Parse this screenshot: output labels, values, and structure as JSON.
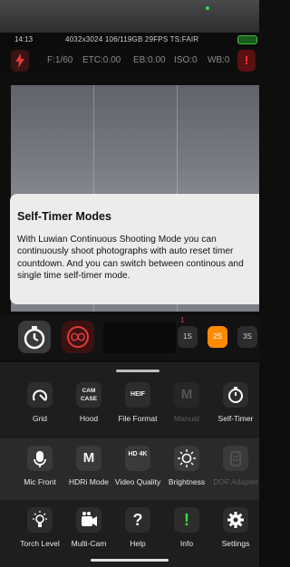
{
  "colors": {
    "accent": "#ff8a00",
    "alert": "#ff3838",
    "battery": "#3fbf3f"
  },
  "status_bar": {
    "time": "14:13",
    "info": "4032x3024 106/119GB 29FPS TS:FAIR"
  },
  "exposure_bar": {
    "flash_icon": "flash-icon",
    "f_stop": "F:1/60",
    "etc": "ETC:0.00",
    "eb": "EB:0.00",
    "iso": "ISO:0",
    "wb": "WB:0",
    "alert_label": "!"
  },
  "popup": {
    "title": "Self-Timer Modes",
    "body": "With Luwian Continuous Shooting Mode you can continuously shoot photographs with auto reset timer countdown. And you can switch between continous and single time self-timer mode."
  },
  "timer_row": {
    "marker": "1",
    "options": [
      "1S",
      "2S",
      "3S"
    ],
    "selected": "2S"
  },
  "tools": {
    "row1": [
      {
        "label": "Grid",
        "glyph": "",
        "icon": "grid-icon",
        "enabled": true
      },
      {
        "label": "Hood",
        "glyph": "CAM CASE",
        "icon": "hood-icon",
        "enabled": true
      },
      {
        "label": "File Format",
        "glyph": "HEIF",
        "icon": "file-format-icon",
        "enabled": true
      },
      {
        "label": "Manual",
        "glyph": "M",
        "icon": "manual-icon",
        "enabled": false
      },
      {
        "label": "Self-Timer",
        "glyph": "",
        "icon": "self-timer-icon",
        "enabled": true
      }
    ],
    "row2": [
      {
        "label": "Mic Front",
        "glyph": "",
        "icon": "mic-icon",
        "enabled": true
      },
      {
        "label": "HDRi Mode",
        "glyph": "M",
        "icon": "hdri-mode-icon",
        "enabled": true
      },
      {
        "label": "Video Quality",
        "glyph": "HD 4K",
        "icon": "video-quality-icon",
        "enabled": true
      },
      {
        "label": "Brightness",
        "glyph": "",
        "icon": "brightness-icon",
        "enabled": true
      },
      {
        "label": "DOF Adapter",
        "glyph": "",
        "icon": "dof-adapter-icon",
        "enabled": false
      }
    ],
    "row3": [
      {
        "label": "Torch Level",
        "glyph": "",
        "icon": "torch-icon",
        "enabled": true
      },
      {
        "label": "Multi-Cam",
        "glyph": "",
        "icon": "multi-cam-icon",
        "enabled": true
      },
      {
        "label": "Help",
        "glyph": "?",
        "icon": "help-icon",
        "enabled": true
      },
      {
        "label": "Info",
        "glyph": "!",
        "icon": "info-icon",
        "enabled": true
      },
      {
        "label": "Settings",
        "glyph": "",
        "icon": "settings-icon",
        "enabled": true
      }
    ]
  }
}
